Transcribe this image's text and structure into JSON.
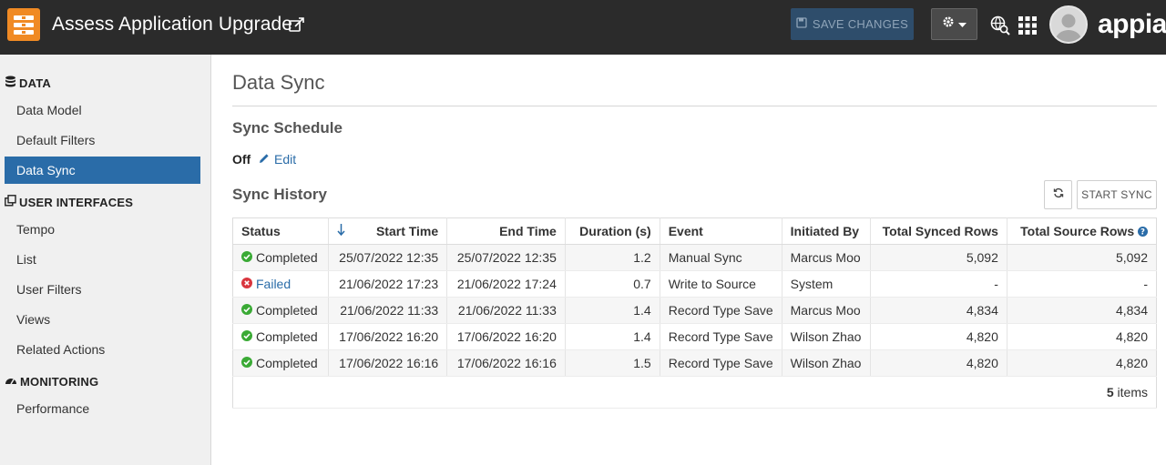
{
  "header": {
    "title": "Assess Application Upgrade",
    "save_label": "SAVE CHANGES",
    "brand": "appian",
    "icons": [
      "app-logo-icon",
      "open-in-new-icon",
      "save-icon",
      "gear-icon",
      "caret-down-icon",
      "search-globe-icon",
      "apps-grid-icon",
      "avatar"
    ]
  },
  "sidebar": {
    "sections": [
      {
        "title": "DATA",
        "icon": "database-icon"
      },
      {
        "title": "USER INTERFACES",
        "icon": "interfaces-icon"
      },
      {
        "title": "MONITORING",
        "icon": "dashboard-icon"
      }
    ],
    "items": [
      {
        "label": "Data Model"
      },
      {
        "label": "Default Filters"
      },
      {
        "label": "Data Sync",
        "active": true
      },
      {
        "label": "Tempo"
      },
      {
        "label": "List"
      },
      {
        "label": "User Filters"
      },
      {
        "label": "Views"
      },
      {
        "label": "Related Actions"
      },
      {
        "label": "Performance"
      }
    ]
  },
  "main": {
    "title": "Data Sync",
    "schedule_heading": "Sync Schedule",
    "schedule_value": "Off",
    "edit_label": "Edit",
    "history_heading": "Sync History",
    "start_sync_label": "START SYNC",
    "columns": [
      "Status",
      "Start Time",
      "End Time",
      "Duration (s)",
      "Event",
      "Initiated By",
      "Total Synced Rows",
      "Total Source Rows"
    ],
    "rows": [
      {
        "status": "Completed",
        "start": "25/07/2022 12:35",
        "end": "25/07/2022 12:35",
        "duration": "1.2",
        "event": "Manual Sync",
        "by": "Marcus Moo",
        "synced": "5,092",
        "source": "5,092"
      },
      {
        "status": "Failed",
        "start": "21/06/2022 17:23",
        "end": "21/06/2022 17:24",
        "duration": "0.7",
        "event": "Write to Source",
        "by": "System",
        "synced": "-",
        "source": "-"
      },
      {
        "status": "Completed",
        "start": "21/06/2022 11:33",
        "end": "21/06/2022 11:33",
        "duration": "1.4",
        "event": "Record Type Save",
        "by": "Marcus Moo",
        "synced": "4,834",
        "source": "4,834"
      },
      {
        "status": "Completed",
        "start": "17/06/2022 16:20",
        "end": "17/06/2022 16:20",
        "duration": "1.4",
        "event": "Record Type Save",
        "by": "Wilson Zhao",
        "synced": "4,820",
        "source": "4,820"
      },
      {
        "status": "Completed",
        "start": "17/06/2022 16:16",
        "end": "17/06/2022 16:16",
        "duration": "1.5",
        "event": "Record Type Save",
        "by": "Wilson Zhao",
        "synced": "4,820",
        "source": "4,820"
      }
    ],
    "item_count": "5",
    "item_count_label": "items"
  },
  "colors": {
    "header_bg": "#2b2b2b",
    "accent": "#2a6ca8",
    "logo": "#f08a24",
    "success": "#3aaa35",
    "error": "#d9363e"
  }
}
